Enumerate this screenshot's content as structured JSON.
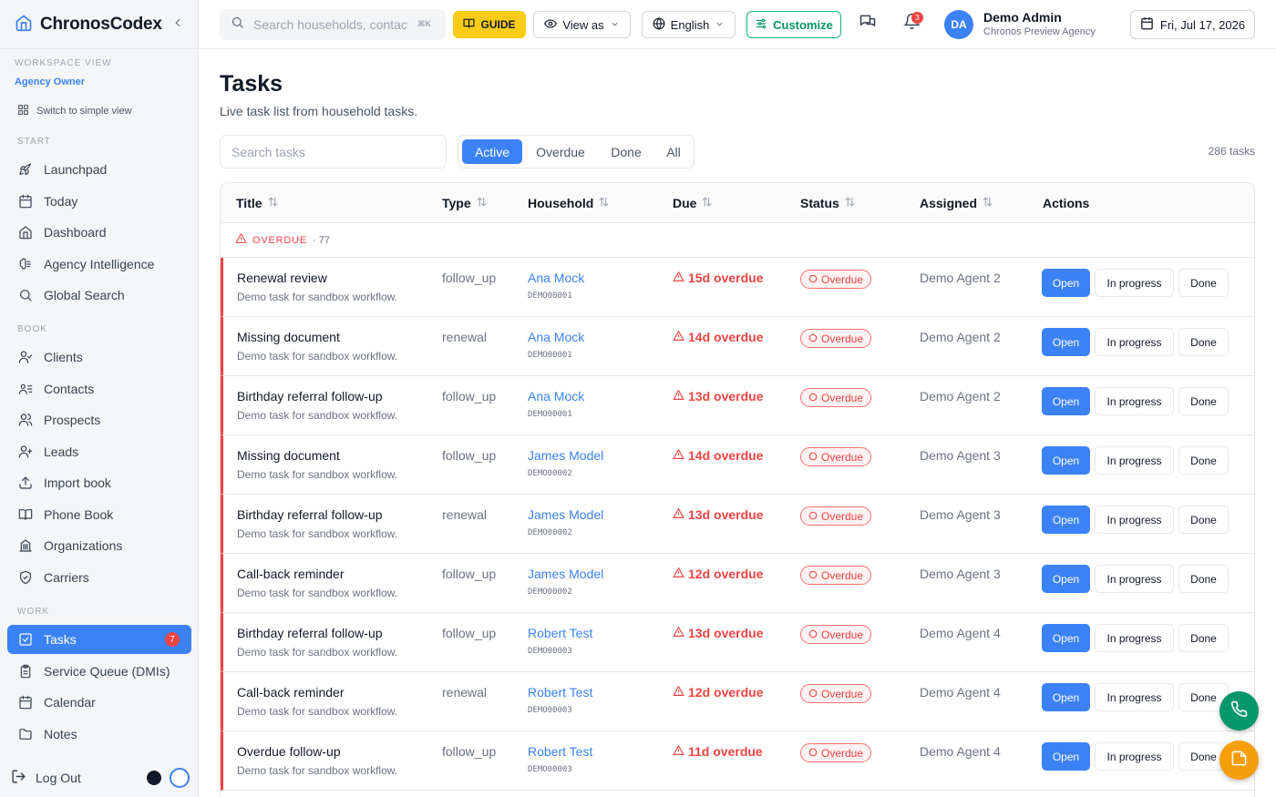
{
  "app": {
    "name": "ChronosCodex"
  },
  "colors": {
    "accent": "#3b82f6",
    "danger": "#ef4444",
    "guide": "#facc15",
    "customize": "#10b981",
    "fab_phone": "#059669",
    "fab_note": "#f59e0b"
  },
  "sidebar": {
    "workspace_label": "WORKSPACE VIEW",
    "workspace_role": "Agency Owner",
    "switch_label": "Switch to simple view",
    "sections": [
      {
        "label": "START",
        "items": [
          {
            "label": "Launchpad",
            "icon": "rocket-icon"
          },
          {
            "label": "Today",
            "icon": "calendar-icon"
          },
          {
            "label": "Dashboard",
            "icon": "home-icon"
          },
          {
            "label": "Agency Intelligence",
            "icon": "brain-icon"
          },
          {
            "label": "Global Search",
            "icon": "search-icon"
          }
        ]
      },
      {
        "label": "BOOK",
        "items": [
          {
            "label": "Clients",
            "icon": "user-check-icon"
          },
          {
            "label": "Contacts",
            "icon": "contacts-icon"
          },
          {
            "label": "Prospects",
            "icon": "users-icon"
          },
          {
            "label": "Leads",
            "icon": "user-plus-icon"
          },
          {
            "label": "Import book",
            "icon": "upload-icon"
          },
          {
            "label": "Phone Book",
            "icon": "book-icon"
          },
          {
            "label": "Organizations",
            "icon": "building-icon"
          },
          {
            "label": "Carriers",
            "icon": "shield-icon"
          }
        ]
      },
      {
        "label": "WORK",
        "items": [
          {
            "label": "Tasks",
            "icon": "checkbox-icon",
            "active": true,
            "badge": "7"
          },
          {
            "label": "Service Queue (DMIs)",
            "icon": "clipboard-icon"
          },
          {
            "label": "Calendar",
            "icon": "calendar-icon"
          },
          {
            "label": "Notes",
            "icon": "folder-icon"
          }
        ]
      }
    ],
    "logout_label": "Log Out"
  },
  "topbar": {
    "search_placeholder": "Search households, contacts…",
    "search_shortcut": "⌘K",
    "guide_label": "GUIDE",
    "view_as_label": "View as",
    "language_label": "English",
    "customize_label": "Customize",
    "notification_count": "3",
    "user": {
      "initials": "DA",
      "name": "Demo Admin",
      "org": "Chronos Preview Agency"
    },
    "date": "Fri, Jul 17, 2026"
  },
  "page": {
    "title": "Tasks",
    "subtitle": "Live task list from household tasks.",
    "search_placeholder": "Search tasks",
    "filters": [
      "Active",
      "Overdue",
      "Done",
      "All"
    ],
    "active_filter": "Active",
    "task_count": "286 tasks"
  },
  "table": {
    "columns": [
      "Title",
      "Type",
      "Household",
      "Due",
      "Status",
      "Assigned",
      "Actions"
    ],
    "group": {
      "label": "OVERDUE",
      "count": "· 77"
    },
    "action_labels": {
      "open": "Open",
      "in_progress": "In progress",
      "done": "Done"
    },
    "rows": [
      {
        "title": "Renewal review",
        "desc": "Demo task for sandbox workflow.",
        "type": "follow_up",
        "household": "Ana Mock",
        "household_id": "DEMO00001",
        "due": "15d overdue",
        "status": "Overdue",
        "assigned": "Demo Agent 2"
      },
      {
        "title": "Missing document",
        "desc": "Demo task for sandbox workflow.",
        "type": "renewal",
        "household": "Ana Mock",
        "household_id": "DEMO00001",
        "due": "14d overdue",
        "status": "Overdue",
        "assigned": "Demo Agent 2"
      },
      {
        "title": "Birthday referral follow-up",
        "desc": "Demo task for sandbox workflow.",
        "type": "follow_up",
        "household": "Ana Mock",
        "household_id": "DEMO00001",
        "due": "13d overdue",
        "status": "Overdue",
        "assigned": "Demo Agent 2"
      },
      {
        "title": "Missing document",
        "desc": "Demo task for sandbox workflow.",
        "type": "follow_up",
        "household": "James Model",
        "household_id": "DEMO00002",
        "due": "14d overdue",
        "status": "Overdue",
        "assigned": "Demo Agent 3"
      },
      {
        "title": "Birthday referral follow-up",
        "desc": "Demo task for sandbox workflow.",
        "type": "renewal",
        "household": "James Model",
        "household_id": "DEMO00002",
        "due": "13d overdue",
        "status": "Overdue",
        "assigned": "Demo Agent 3"
      },
      {
        "title": "Call-back reminder",
        "desc": "Demo task for sandbox workflow.",
        "type": "follow_up",
        "household": "James Model",
        "household_id": "DEMO00002",
        "due": "12d overdue",
        "status": "Overdue",
        "assigned": "Demo Agent 3"
      },
      {
        "title": "Birthday referral follow-up",
        "desc": "Demo task for sandbox workflow.",
        "type": "follow_up",
        "household": "Robert Test",
        "household_id": "DEMO00003",
        "due": "13d overdue",
        "status": "Overdue",
        "assigned": "Demo Agent 4"
      },
      {
        "title": "Call-back reminder",
        "desc": "Demo task for sandbox workflow.",
        "type": "renewal",
        "household": "Robert Test",
        "household_id": "DEMO00003",
        "due": "12d overdue",
        "status": "Overdue",
        "assigned": "Demo Agent 4"
      },
      {
        "title": "Overdue follow-up",
        "desc": "Demo task for sandbox workflow.",
        "type": "follow_up",
        "household": "Robert Test",
        "household_id": "DEMO00003",
        "due": "11d overdue",
        "status": "Overdue",
        "assigned": "Demo Agent 4"
      }
    ]
  }
}
